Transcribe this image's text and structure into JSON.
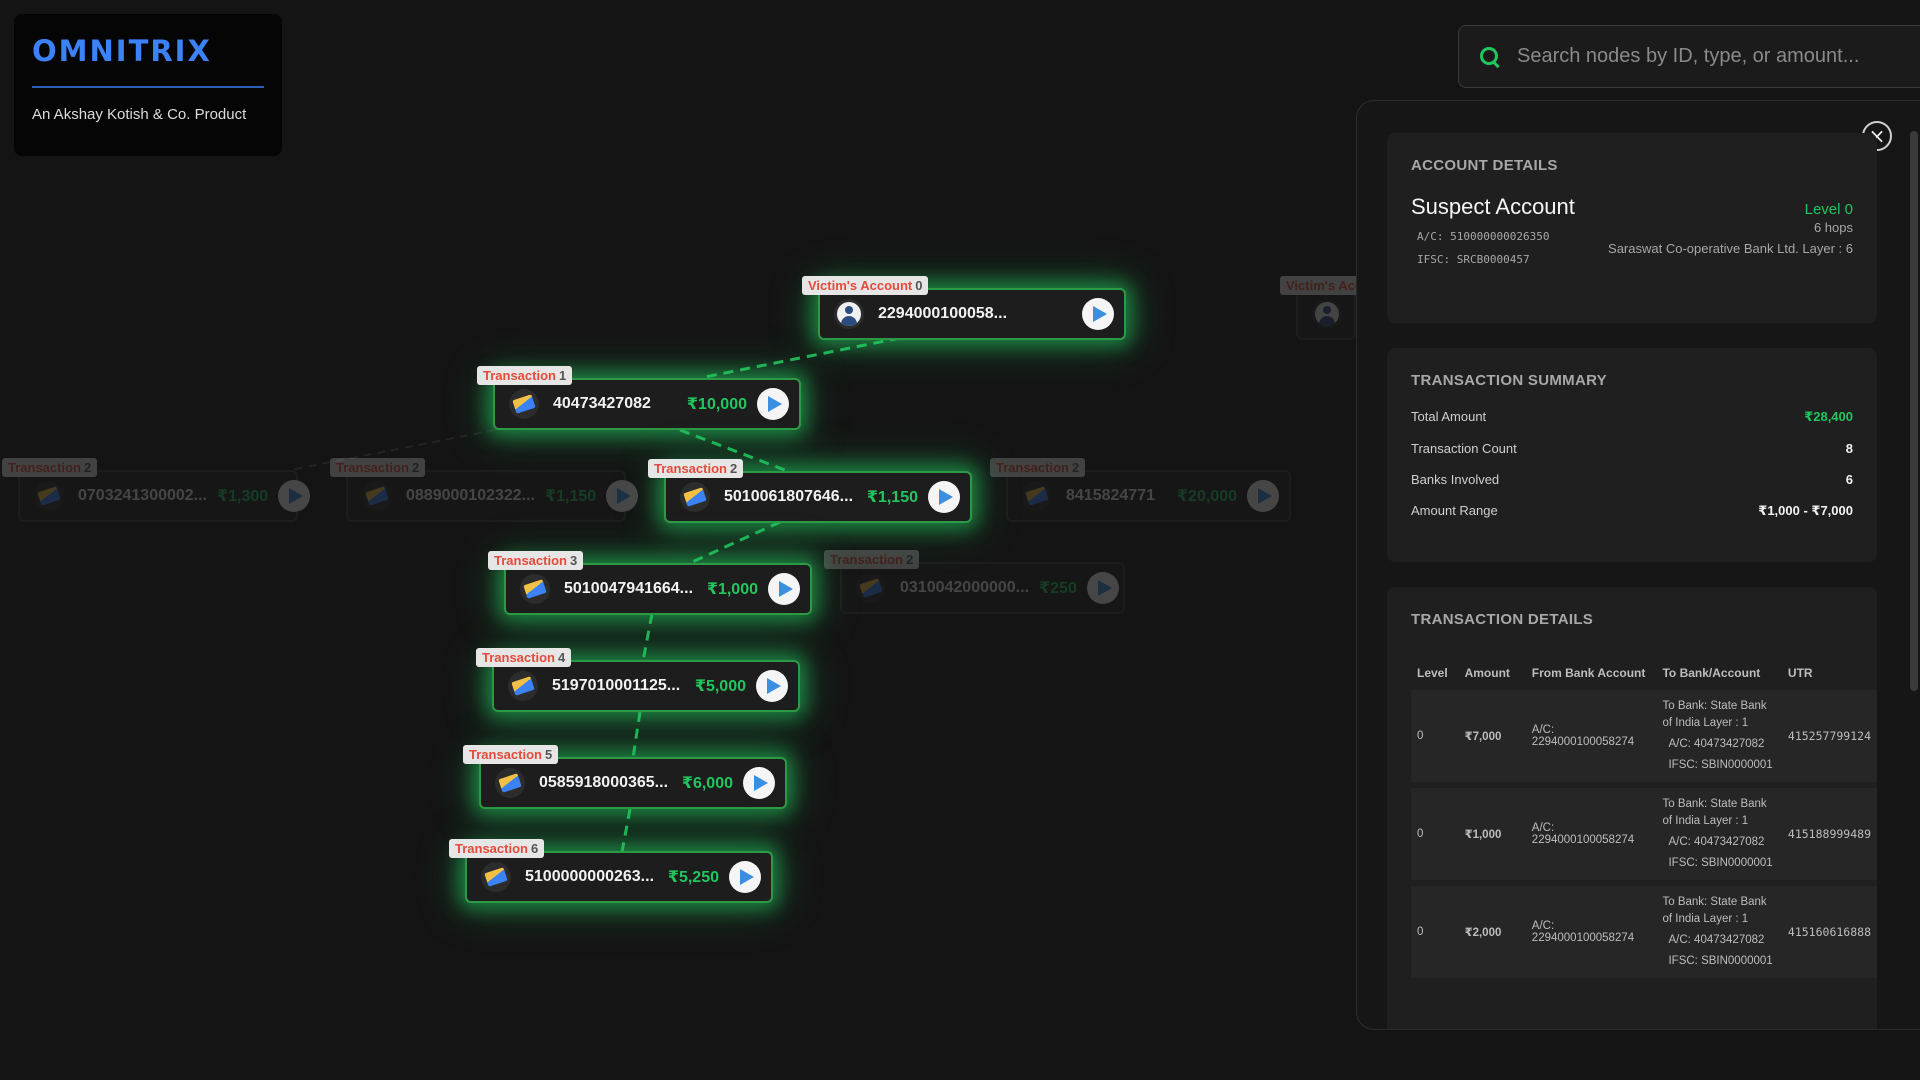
{
  "brand": {
    "title": "OMNITRIX",
    "subtitle": "An Akshay Kotish & Co. Product",
    "accent": "#3b82f6"
  },
  "search": {
    "placeholder": "Search nodes by ID, type, or amount..."
  },
  "graph": {
    "highlight_color": "#22c55e",
    "nodes": [
      {
        "label": "Victim's Account",
        "level": "0",
        "id": "2294000100058...",
        "amount": "",
        "icon": "person-icon",
        "state": "active"
      },
      {
        "label": "Transaction",
        "level": "1",
        "id": "40473427082",
        "amount": "₹10,000",
        "icon": "card-icon",
        "state": "active"
      },
      {
        "label": "Transaction",
        "level": "2",
        "id": "5010061807646...",
        "amount": "₹1,150",
        "icon": "card-icon",
        "state": "active"
      },
      {
        "label": "Transaction",
        "level": "3",
        "id": "5010047941664...",
        "amount": "₹1,000",
        "icon": "card-icon",
        "state": "active"
      },
      {
        "label": "Transaction",
        "level": "4",
        "id": "5197010001125...",
        "amount": "₹5,000",
        "icon": "card-icon",
        "state": "active"
      },
      {
        "label": "Transaction",
        "level": "5",
        "id": "0585918000365...",
        "amount": "₹6,000",
        "icon": "card-icon",
        "state": "active"
      },
      {
        "label": "Transaction",
        "level": "6",
        "id": "5100000000263...",
        "amount": "₹5,250",
        "icon": "card-icon",
        "state": "active"
      },
      {
        "label": "Transaction",
        "level": "2",
        "id": "0703241300002...",
        "amount": "₹1,300",
        "icon": "card-icon",
        "state": "dim"
      },
      {
        "label": "Transaction",
        "level": "2",
        "id": "0889000102322...",
        "amount": "₹1,150",
        "icon": "card-icon",
        "state": "dim"
      },
      {
        "label": "Transaction",
        "level": "2",
        "id": "8415824771",
        "amount": "₹20,000",
        "icon": "card-icon",
        "state": "dim"
      },
      {
        "label": "Transaction",
        "level": "2",
        "id": "0310042000000...",
        "amount": "₹250",
        "icon": "card-icon",
        "state": "dim"
      },
      {
        "label": "Victim's Acco",
        "level": "",
        "id": "",
        "amount": "",
        "icon": "person-icon",
        "state": "dim"
      }
    ]
  },
  "panel": {
    "account": {
      "title": "ACCOUNT DETAILS",
      "name": "Suspect Account",
      "level": "Level 0",
      "hops": "6 hops",
      "ac": "A/C: 510000000026350",
      "ifsc": "IFSC: SRCB0000457",
      "bank": "Saraswat Co-operative Bank Ltd. Layer : 6"
    },
    "summary": {
      "title": "TRANSACTION SUMMARY",
      "rows": [
        {
          "label": "Total Amount",
          "value": "₹28,400"
        },
        {
          "label": "Transaction Count",
          "value": "8"
        },
        {
          "label": "Banks Involved",
          "value": "6"
        },
        {
          "label": "Amount Range",
          "value": "₹1,000 - ₹7,000"
        }
      ]
    },
    "details": {
      "title": "TRANSACTION DETAILS",
      "headers": [
        "Level",
        "Amount",
        "From Bank Account",
        "To Bank/Account",
        "UTR"
      ],
      "rows": [
        {
          "level": "0",
          "amount": "₹7,000",
          "from": "A/C: 2294000100058274",
          "to_bank": "To Bank: State Bank of India Layer : 1",
          "to_ac": "A/C: 40473427082",
          "to_ifsc": "IFSC: SBIN0000001",
          "utr": "415257799124"
        },
        {
          "level": "0",
          "amount": "₹1,000",
          "from": "A/C: 2294000100058274",
          "to_bank": "To Bank: State Bank of India Layer : 1",
          "to_ac": "A/C: 40473427082",
          "to_ifsc": "IFSC: SBIN0000001",
          "utr": "415188999489"
        },
        {
          "level": "0",
          "amount": "₹2,000",
          "from": "A/C: 2294000100058274",
          "to_bank": "To Bank: State Bank of India Layer : 1",
          "to_ac": "A/C: 40473427082",
          "to_ifsc": "IFSC: SBIN0000001",
          "utr": "415160616888"
        }
      ]
    }
  }
}
